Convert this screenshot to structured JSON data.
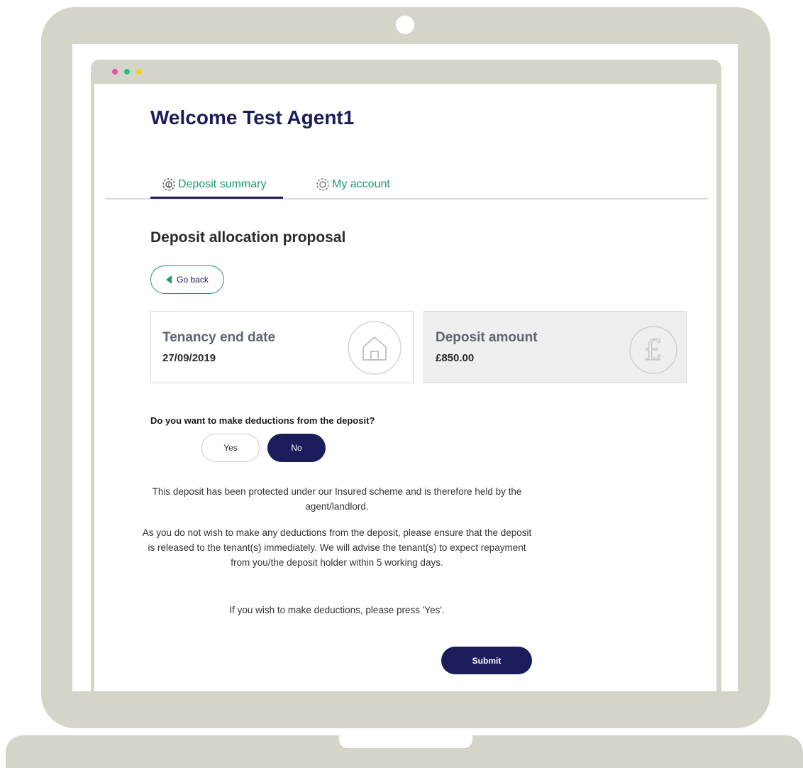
{
  "welcome": {
    "title": "Welcome Test Agent1"
  },
  "tabs": [
    {
      "label": "Deposit summary",
      "icon": "deposit-gear-icon",
      "active": true
    },
    {
      "label": "My account",
      "icon": "gear-icon",
      "active": false
    }
  ],
  "section": {
    "title": "Deposit allocation proposal"
  },
  "go_back": {
    "label": "Go back"
  },
  "cards": {
    "tenancy_end": {
      "label": "Tenancy end date",
      "value": "27/09/2019",
      "icon": "house-icon"
    },
    "deposit_amount": {
      "label": "Deposit amount",
      "value": "£850.00",
      "icon": "pound-icon"
    }
  },
  "question": {
    "text": "Do you want to make deductions from the deposit?",
    "yes_label": "Yes",
    "no_label": "No",
    "selected": "No"
  },
  "info": {
    "p1": "This deposit has been protected under our Insured scheme and is therefore held by the agent/landlord.",
    "p2": "As you do not wish to make any deductions from the deposit, please ensure that the deposit is released to the tenant(s) immediately. We will advise the tenant(s) to expect repayment from you/the deposit holder within 5 working days.",
    "p3": "If you wish to make deductions, please press 'Yes'."
  },
  "submit": {
    "label": "Submit"
  },
  "colors": {
    "brand_navy": "#1b1c5a",
    "accent_green": "#1a9a78",
    "laptop_frame": "#d5d4c8",
    "window_dot_pink": "#f04bbd",
    "window_dot_green": "#21c47a",
    "window_dot_yellow": "#f5cf1c"
  }
}
